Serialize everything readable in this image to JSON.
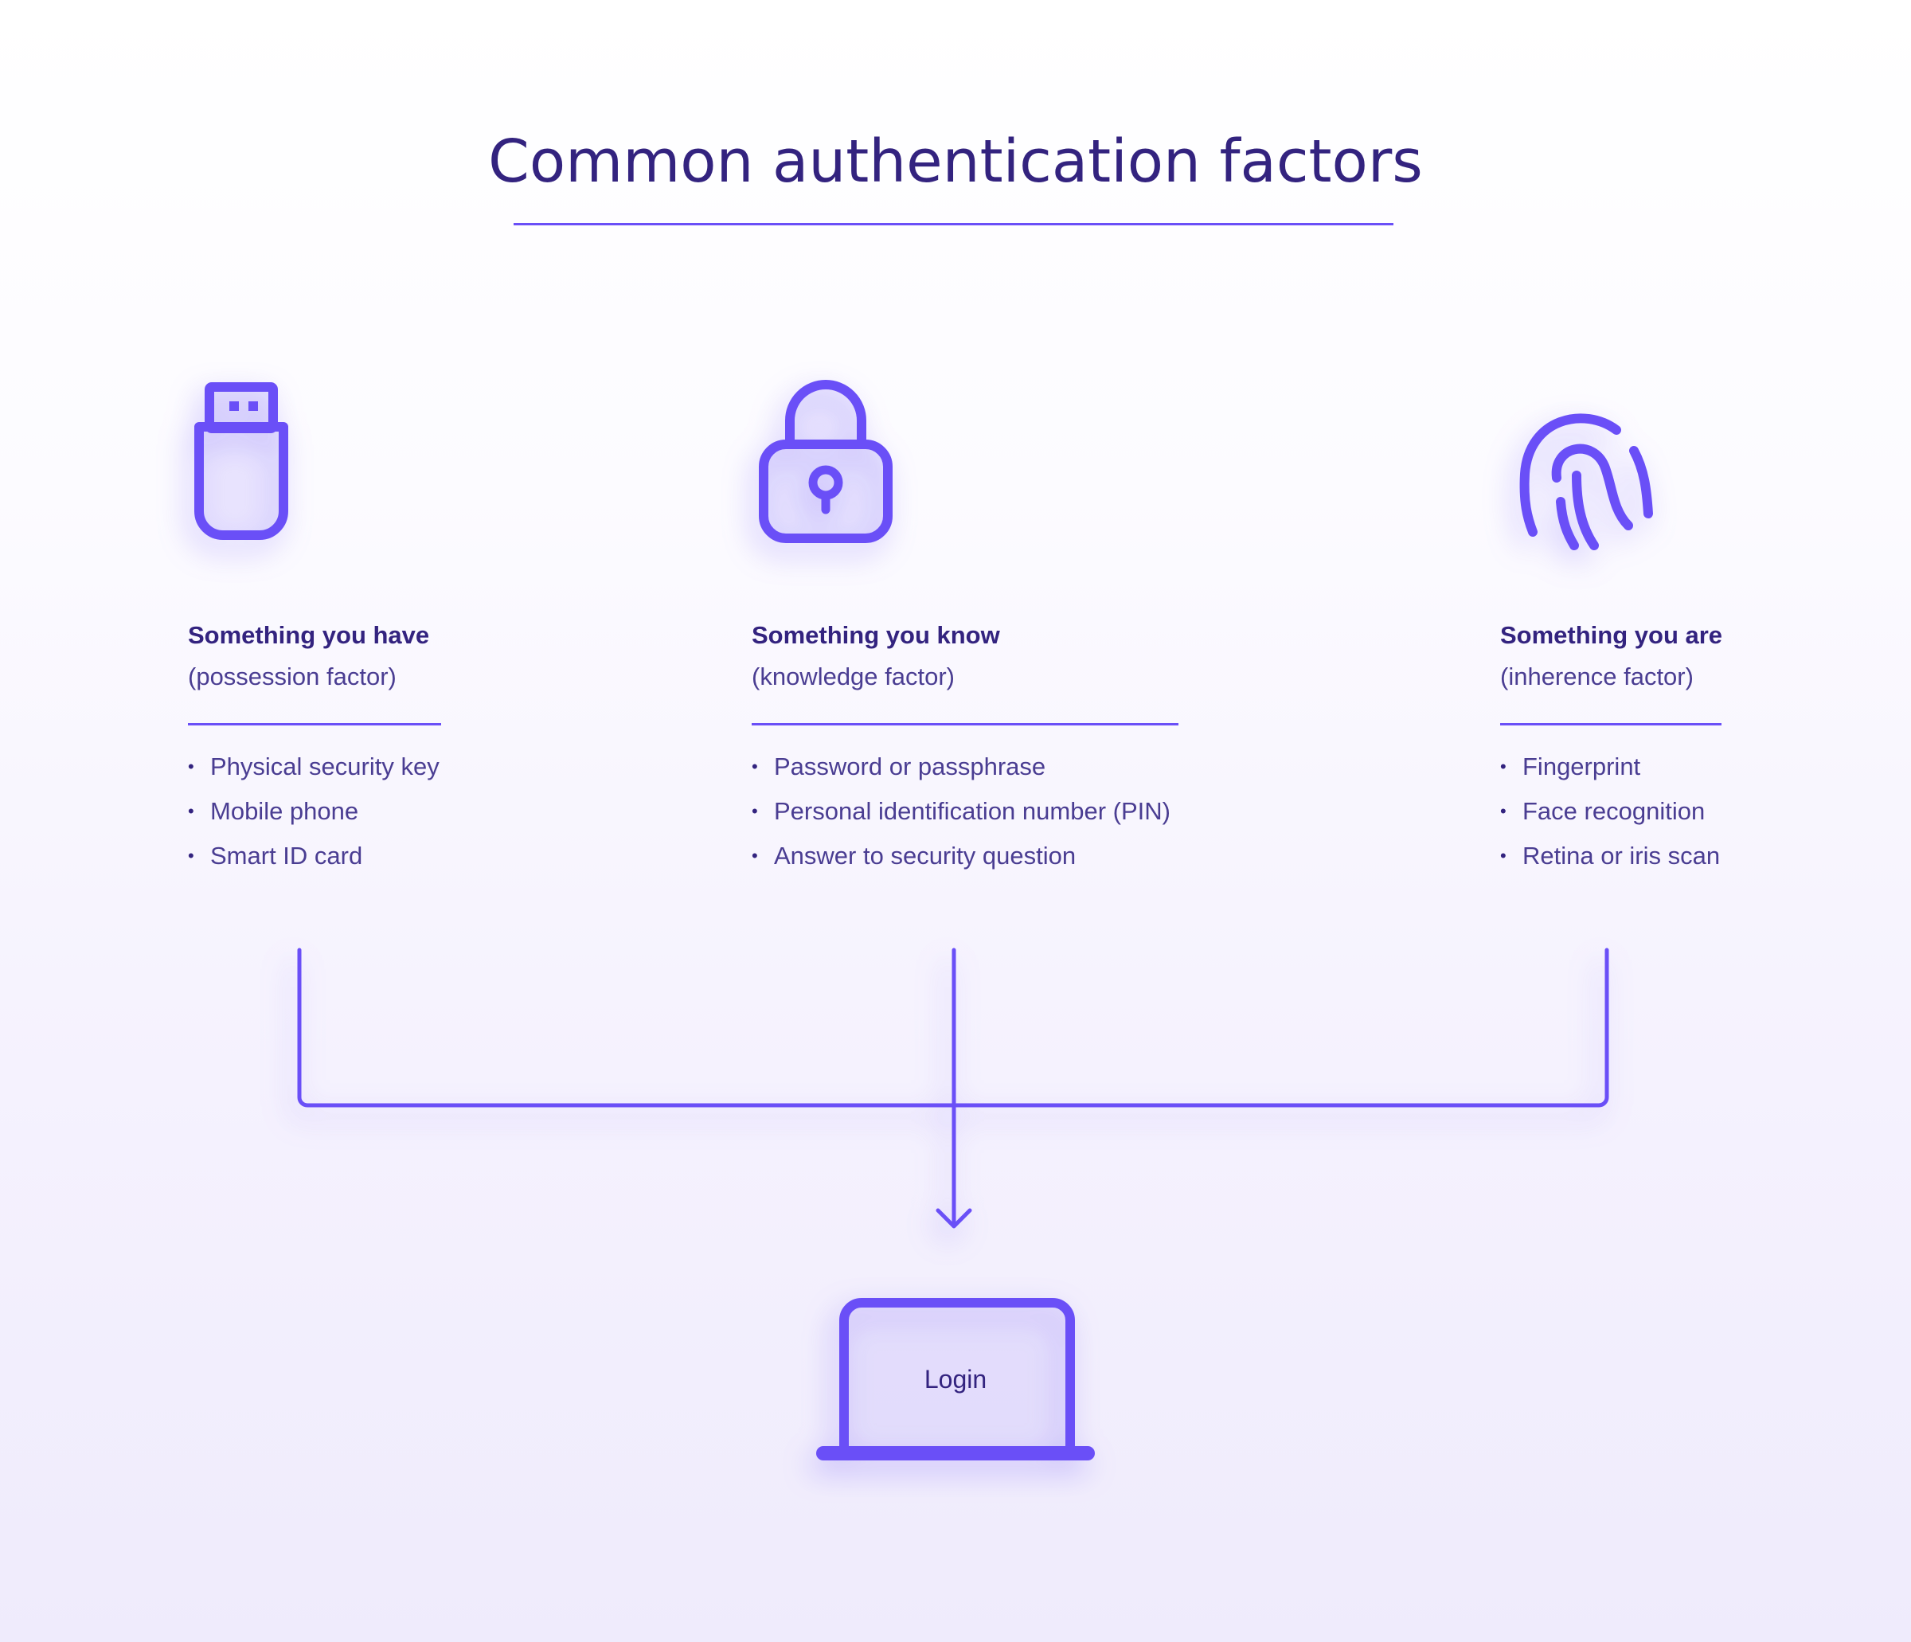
{
  "title": "Common authentication factors",
  "accent_color": "#6a4ff7",
  "text_color": "#33237f",
  "factors": [
    {
      "icon": "usb-key-icon",
      "heading": "Something you have",
      "subtitle": "(possession factor)",
      "items": [
        "Physical security key",
        "Mobile phone",
        "Smart ID card"
      ]
    },
    {
      "icon": "padlock-icon",
      "heading": "Something you know",
      "subtitle": "(knowledge factor)",
      "items": [
        "Password or passphrase",
        "Personal identification number (PIN)",
        "Answer to security question"
      ]
    },
    {
      "icon": "fingerprint-icon",
      "heading": "Something you are",
      "subtitle": "(inherence factor)",
      "items": [
        "Fingerprint",
        "Face recognition",
        "Retina or iris scan"
      ]
    }
  ],
  "target": {
    "icon": "laptop-icon",
    "label": "Login"
  },
  "bullet": "•"
}
